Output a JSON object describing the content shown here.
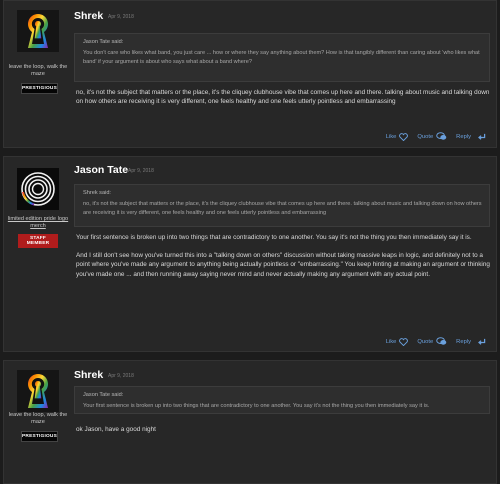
{
  "posts": [
    {
      "author": "Shrek",
      "date": "Apr 9, 2018",
      "user_title": "leave the loop, walk the maze",
      "badge": "PRESTIGIOUS",
      "quote_header": "Jason Tate said:",
      "quote_body": "You don't care who likes what band, you just care ... how or where they say anything about them? How is that tangibly different than caring about 'who likes what band' if your argument is about who says what about a band where?",
      "message": [
        "no, it's not the subject that matters or the place, it's the cliquey clubhouse vibe that comes up here and there. talking about music and talking down on how others are receiving it is very different, one feels healthy and one feels utterly pointless and embarrassing"
      ],
      "actions": {
        "like": "Like",
        "quote": "Quote",
        "reply": "Reply"
      }
    },
    {
      "author": "Jason Tate",
      "date": "Apr 9, 2018",
      "user_title": "limited edition pride logo merch",
      "badge": "STAFF MEMBER",
      "quote_header": "Shrek said:",
      "quote_body": "no, it's not the subject that matters or the place, it's the cliquey clubhouse vibe that comes up here and there. talking about music and talking down on how others are receiving it is very different, one feels healthy and one feels utterly pointless and embarrassing",
      "message": [
        "Your first sentence is broken up into two things that are contradictory to one another. You say it's not the thing you then immediately say it is.",
        "And I still don't see how you've turned this into a \"talking down on others\" discussion without taking massive leaps in logic, and definitely not to a point where you've made any argument to anything being actually pointless or \"embarrassing.\" You keep hinting at making an argument or thinking you've made one ... and then running away saying never mind and never actually making any argument with any actual point."
      ],
      "actions": {
        "like": "Like",
        "quote": "Quote",
        "reply": "Reply"
      }
    },
    {
      "author": "Shrek",
      "date": "Apr 9, 2018",
      "user_title": "leave the loop, walk the maze",
      "badge": "PRESTIGIOUS",
      "quote_header": "Jason Tate said:",
      "quote_body": "Your first sentence is broken up into two things that are contradictory to one another. You say it's not the thing you then immediately say it is.",
      "message": [
        "ok Jason, have a good night"
      ],
      "actions": {
        "like": "Like",
        "quote": "Quote",
        "reply": "Reply"
      }
    }
  ],
  "colors": {
    "background": "#1c1c1c",
    "post": "#272727",
    "link": "#6aa0dd",
    "staff_badge": "#b01c1c"
  },
  "icons": [
    "keyhole-avatar",
    "rings-avatar",
    "heart-icon",
    "quote-bubble-icon",
    "reply-arrow-icon"
  ]
}
